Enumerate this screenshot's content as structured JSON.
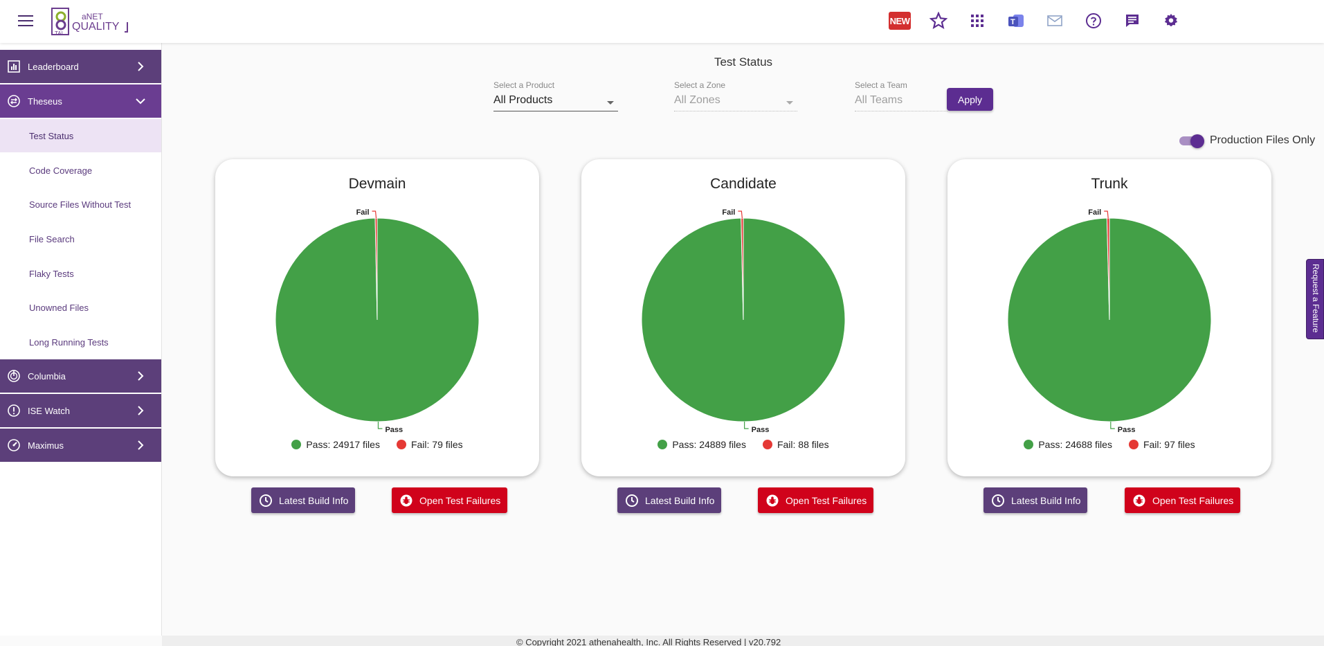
{
  "header": {
    "logo_text_top": "aNET",
    "logo_text_main": "QUALITY",
    "logo_text_small": "TAI",
    "new_badge": "NEW",
    "icons": [
      "favorites-star-icon",
      "apps-grid-icon",
      "teams-icon",
      "mail-icon",
      "help-icon",
      "chat-icon",
      "settings-gear-icon"
    ]
  },
  "sidebar": {
    "groups": [
      {
        "label": "Leaderboard",
        "icon": "leaderboard-icon",
        "expanded": false
      },
      {
        "label": "Theseus",
        "icon": "theseus-icon",
        "expanded": true
      },
      {
        "label": "Columbia",
        "icon": "columbia-icon",
        "expanded": false
      },
      {
        "label": "ISE Watch",
        "icon": "ise-watch-icon",
        "expanded": false
      },
      {
        "label": "Maximus",
        "icon": "maximus-icon",
        "expanded": false
      }
    ],
    "theseus_items": [
      {
        "label": "Test Status",
        "active": true
      },
      {
        "label": "Code Coverage"
      },
      {
        "label": "Source Files Without Test"
      },
      {
        "label": "File Search"
      },
      {
        "label": "Flaky Tests"
      },
      {
        "label": "Unowned Files"
      },
      {
        "label": "Long Running Tests"
      }
    ]
  },
  "main": {
    "title": "Test Status",
    "filters": {
      "product": {
        "label": "Select a Product",
        "value": "All Products"
      },
      "zone": {
        "label": "Select a Zone",
        "value": "All Zones"
      },
      "team": {
        "label": "Select a Team",
        "value": "All Teams"
      }
    },
    "apply_label": "Apply",
    "toggle_label": "Production Files Only",
    "toggle_on": true,
    "build_button_label": "Latest Build Info",
    "failures_button_label": "Open Test Failures"
  },
  "colors": {
    "pass": "#43a047",
    "fail": "#e53935",
    "purple": "#5c2d91"
  },
  "chart_data": [
    {
      "type": "pie",
      "title": "Devmain",
      "categories": [
        "Pass",
        "Fail"
      ],
      "values": [
        24917,
        79
      ],
      "legend": [
        "Pass: 24917 files",
        "Fail: 79 files"
      ]
    },
    {
      "type": "pie",
      "title": "Candidate",
      "categories": [
        "Pass",
        "Fail"
      ],
      "values": [
        24889,
        88
      ],
      "legend": [
        "Pass: 24889 files",
        "Fail: 88 files"
      ]
    },
    {
      "type": "pie",
      "title": "Trunk",
      "categories": [
        "Pass",
        "Fail"
      ],
      "values": [
        24688,
        97
      ],
      "legend": [
        "Pass: 24688 files",
        "Fail: 97 files"
      ]
    }
  ],
  "feature_tab": "Request a Feature",
  "footer": "© Copyright 2021 athenahealth, Inc. All Rights Reserved |   v20.792"
}
